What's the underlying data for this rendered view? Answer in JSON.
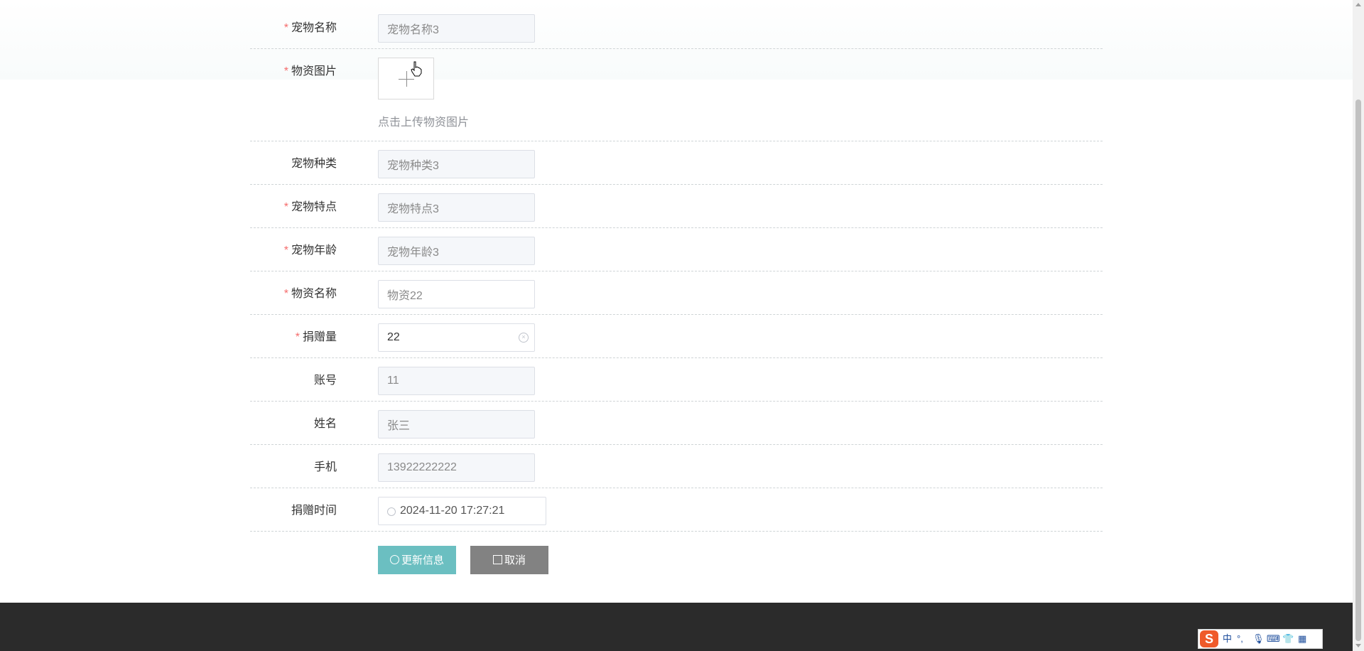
{
  "form": {
    "fields": [
      {
        "label": "宠物名称",
        "required": true,
        "value": "宠物名称3"
      },
      {
        "label": "物资图片",
        "required": true,
        "hint": "点击上传物资图片"
      },
      {
        "label": "宠物种类",
        "required": false,
        "value": "宠物种类3"
      },
      {
        "label": "宠物特点",
        "required": true,
        "value": "宠物特点3"
      },
      {
        "label": "宠物年龄",
        "required": true,
        "value": "宠物年龄3"
      },
      {
        "label": "物资名称",
        "required": true,
        "value": "物资22"
      },
      {
        "label": "捐赠量",
        "required": true,
        "value": "22"
      },
      {
        "label": "账号",
        "required": false,
        "value": "11"
      },
      {
        "label": "姓名",
        "required": false,
        "value": "张三"
      },
      {
        "label": "手机",
        "required": false,
        "value": "13922222222"
      },
      {
        "label": "捐赠时间",
        "required": false,
        "value": "2024-11-20 17:27:21"
      }
    ],
    "required_mark": "*",
    "buttons": {
      "update": "更新信息",
      "cancel": "取消"
    }
  },
  "ime": {
    "logo": "S",
    "lang": "中",
    "punct": "°,"
  },
  "colors": {
    "primary_button": "#6bbfc1",
    "cancel_button": "#828282",
    "required_star": "#f56c6c",
    "footer": "#2b2b2b"
  }
}
